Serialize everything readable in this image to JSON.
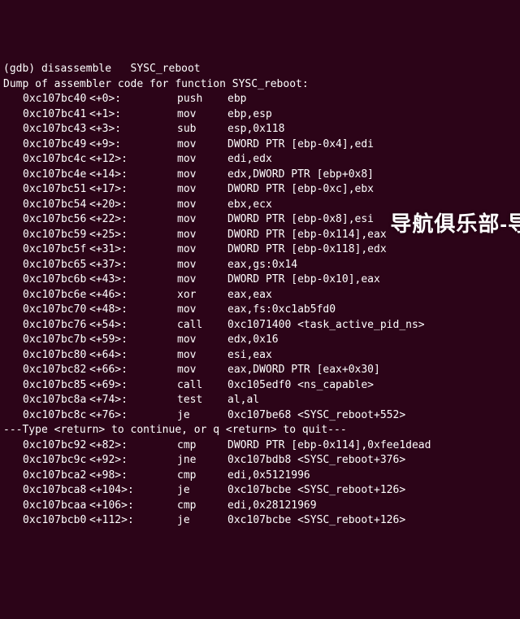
{
  "prompt": "(gdb) disassemble   SYSC_reboot",
  "dump_header": "Dump of assembler code for function SYSC_reboot:",
  "pager_hint": "---Type <return> to continue, or q <return> to quit---",
  "watermark": "导航俱乐部-导",
  "rows": [
    {
      "addr": "0xc107bc40",
      "off": "<+0>:",
      "mn": "push",
      "args": "ebp"
    },
    {
      "addr": "0xc107bc41",
      "off": "<+1>:",
      "mn": "mov",
      "args": "ebp,esp"
    },
    {
      "addr": "0xc107bc43",
      "off": "<+3>:",
      "mn": "sub",
      "args": "esp,0x118"
    },
    {
      "addr": "0xc107bc49",
      "off": "<+9>:",
      "mn": "mov",
      "args": "DWORD PTR [ebp-0x4],edi"
    },
    {
      "addr": "0xc107bc4c",
      "off": "<+12>:",
      "mn": "mov",
      "args": "edi,edx"
    },
    {
      "addr": "0xc107bc4e",
      "off": "<+14>:",
      "mn": "mov",
      "args": "edx,DWORD PTR [ebp+0x8]"
    },
    {
      "addr": "0xc107bc51",
      "off": "<+17>:",
      "mn": "mov",
      "args": "DWORD PTR [ebp-0xc],ebx"
    },
    {
      "addr": "0xc107bc54",
      "off": "<+20>:",
      "mn": "mov",
      "args": "ebx,ecx"
    },
    {
      "addr": "0xc107bc56",
      "off": "<+22>:",
      "mn": "mov",
      "args": "DWORD PTR [ebp-0x8],esi"
    },
    {
      "addr": "0xc107bc59",
      "off": "<+25>:",
      "mn": "mov",
      "args": "DWORD PTR [ebp-0x114],eax"
    },
    {
      "addr": "0xc107bc5f",
      "off": "<+31>:",
      "mn": "mov",
      "args": "DWORD PTR [ebp-0x118],edx"
    },
    {
      "addr": "0xc107bc65",
      "off": "<+37>:",
      "mn": "mov",
      "args": "eax,gs:0x14"
    },
    {
      "addr": "0xc107bc6b",
      "off": "<+43>:",
      "mn": "mov",
      "args": "DWORD PTR [ebp-0x10],eax"
    },
    {
      "addr": "0xc107bc6e",
      "off": "<+46>:",
      "mn": "xor",
      "args": "eax,eax"
    },
    {
      "addr": "0xc107bc70",
      "off": "<+48>:",
      "mn": "mov",
      "args": "eax,fs:0xc1ab5fd0"
    },
    {
      "addr": "0xc107bc76",
      "off": "<+54>:",
      "mn": "call",
      "args": "0xc1071400 <task_active_pid_ns>"
    },
    {
      "addr": "0xc107bc7b",
      "off": "<+59>:",
      "mn": "mov",
      "args": "edx,0x16"
    },
    {
      "addr": "0xc107bc80",
      "off": "<+64>:",
      "mn": "mov",
      "args": "esi,eax"
    },
    {
      "addr": "0xc107bc82",
      "off": "<+66>:",
      "mn": "mov",
      "args": "eax,DWORD PTR [eax+0x30]"
    },
    {
      "addr": "0xc107bc85",
      "off": "<+69>:",
      "mn": "call",
      "args": "0xc105edf0 <ns_capable>"
    },
    {
      "addr": "0xc107bc8a",
      "off": "<+74>:",
      "mn": "test",
      "args": "al,al"
    },
    {
      "addr": "0xc107bc8c",
      "off": "<+76>:",
      "mn": "je",
      "args": "0xc107be68 <SYSC_reboot+552>"
    },
    {
      "addr": "0xc107bc92",
      "off": "<+82>:",
      "mn": "cmp",
      "args": "DWORD PTR [ebp-0x114],0xfee1dead"
    },
    {
      "addr": "0xc107bc9c",
      "off": "<+92>:",
      "mn": "jne",
      "args": "0xc107bdb8 <SYSC_reboot+376>"
    },
    {
      "addr": "0xc107bca2",
      "off": "<+98>:",
      "mn": "cmp",
      "args": "edi,0x5121996"
    },
    {
      "addr": "0xc107bca8",
      "off": "<+104>:",
      "mn": "je",
      "args": "0xc107bcbe <SYSC_reboot+126>"
    },
    {
      "addr": "0xc107bcaa",
      "off": "<+106>:",
      "mn": "cmp",
      "args": "edi,0x28121969"
    },
    {
      "addr": "0xc107bcb0",
      "off": "<+112>:",
      "mn": "je",
      "args": "0xc107bcbe <SYSC_reboot+126>"
    }
  ],
  "pager_after_index": 22
}
